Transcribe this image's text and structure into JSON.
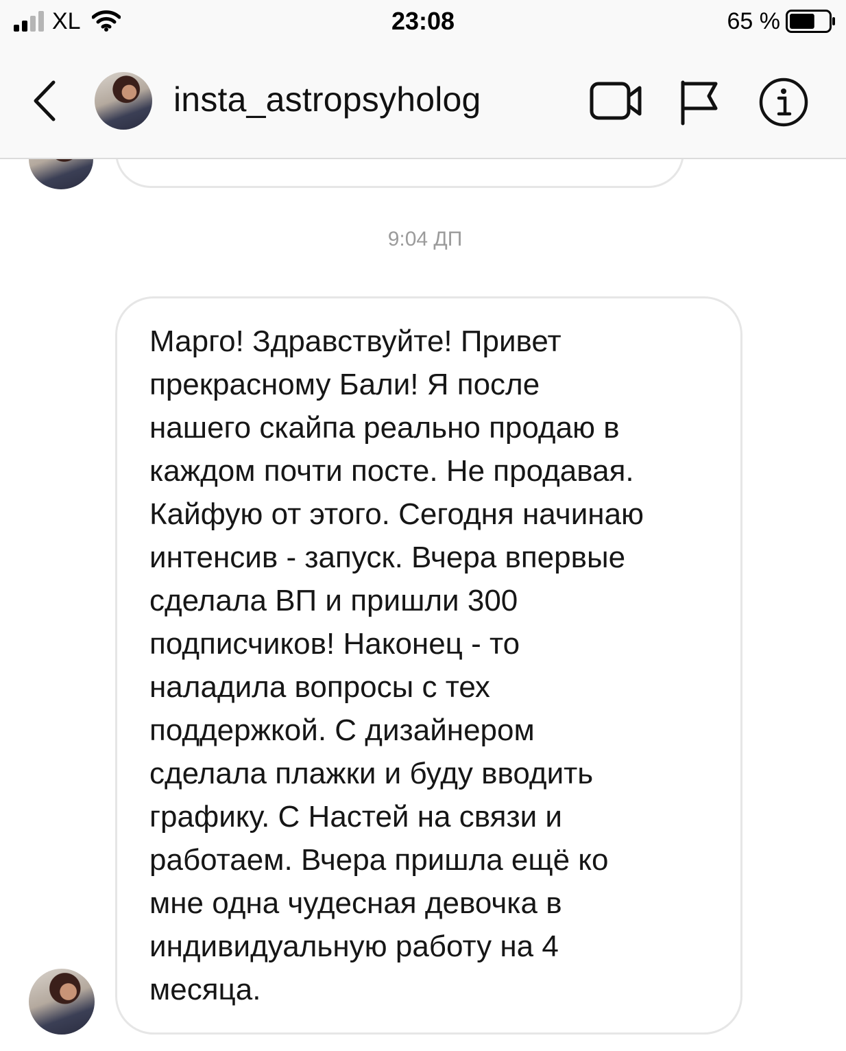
{
  "status_bar": {
    "carrier": "XL",
    "time": "23:08",
    "battery_percent": "65 %",
    "battery_level": 0.65,
    "icons": [
      "signal-icon",
      "wifi-icon",
      "battery-icon"
    ]
  },
  "header": {
    "username": "insta_astropsyholog",
    "icons": [
      "back-chevron-icon",
      "avatar",
      "video-camera-icon",
      "flag-icon",
      "info-icon"
    ]
  },
  "chat": {
    "timestamp": "9:04 ДП",
    "message_lines": [
      "Марго! Здравствуйте! Привет",
      "прекрасному Бали! Я после",
      "нашего скайпа реально продаю в",
      "каждом почти посте. Не продавая.",
      "Кайфую от этого. Сегодня начинаю",
      "интенсив - запуск. Вчера впервые",
      "сделала ВП и пришли 300",
      "подписчиков! Наконец - то",
      "наладила вопросы с тех",
      "поддержкой. С дизайнером",
      "сделала плажки и буду вводить",
      "графику. С Настей на связи и",
      "работаем. Вчера пришла ещё ко",
      "мне одна чудесная девочка в",
      "индивидуальную работу на 4",
      "месяца."
    ]
  },
  "colors": {
    "header_bg": "#f9f9f9",
    "bubble_border": "#e6e6e6",
    "timestamp": "#9b9b9b",
    "text": "#161616"
  }
}
